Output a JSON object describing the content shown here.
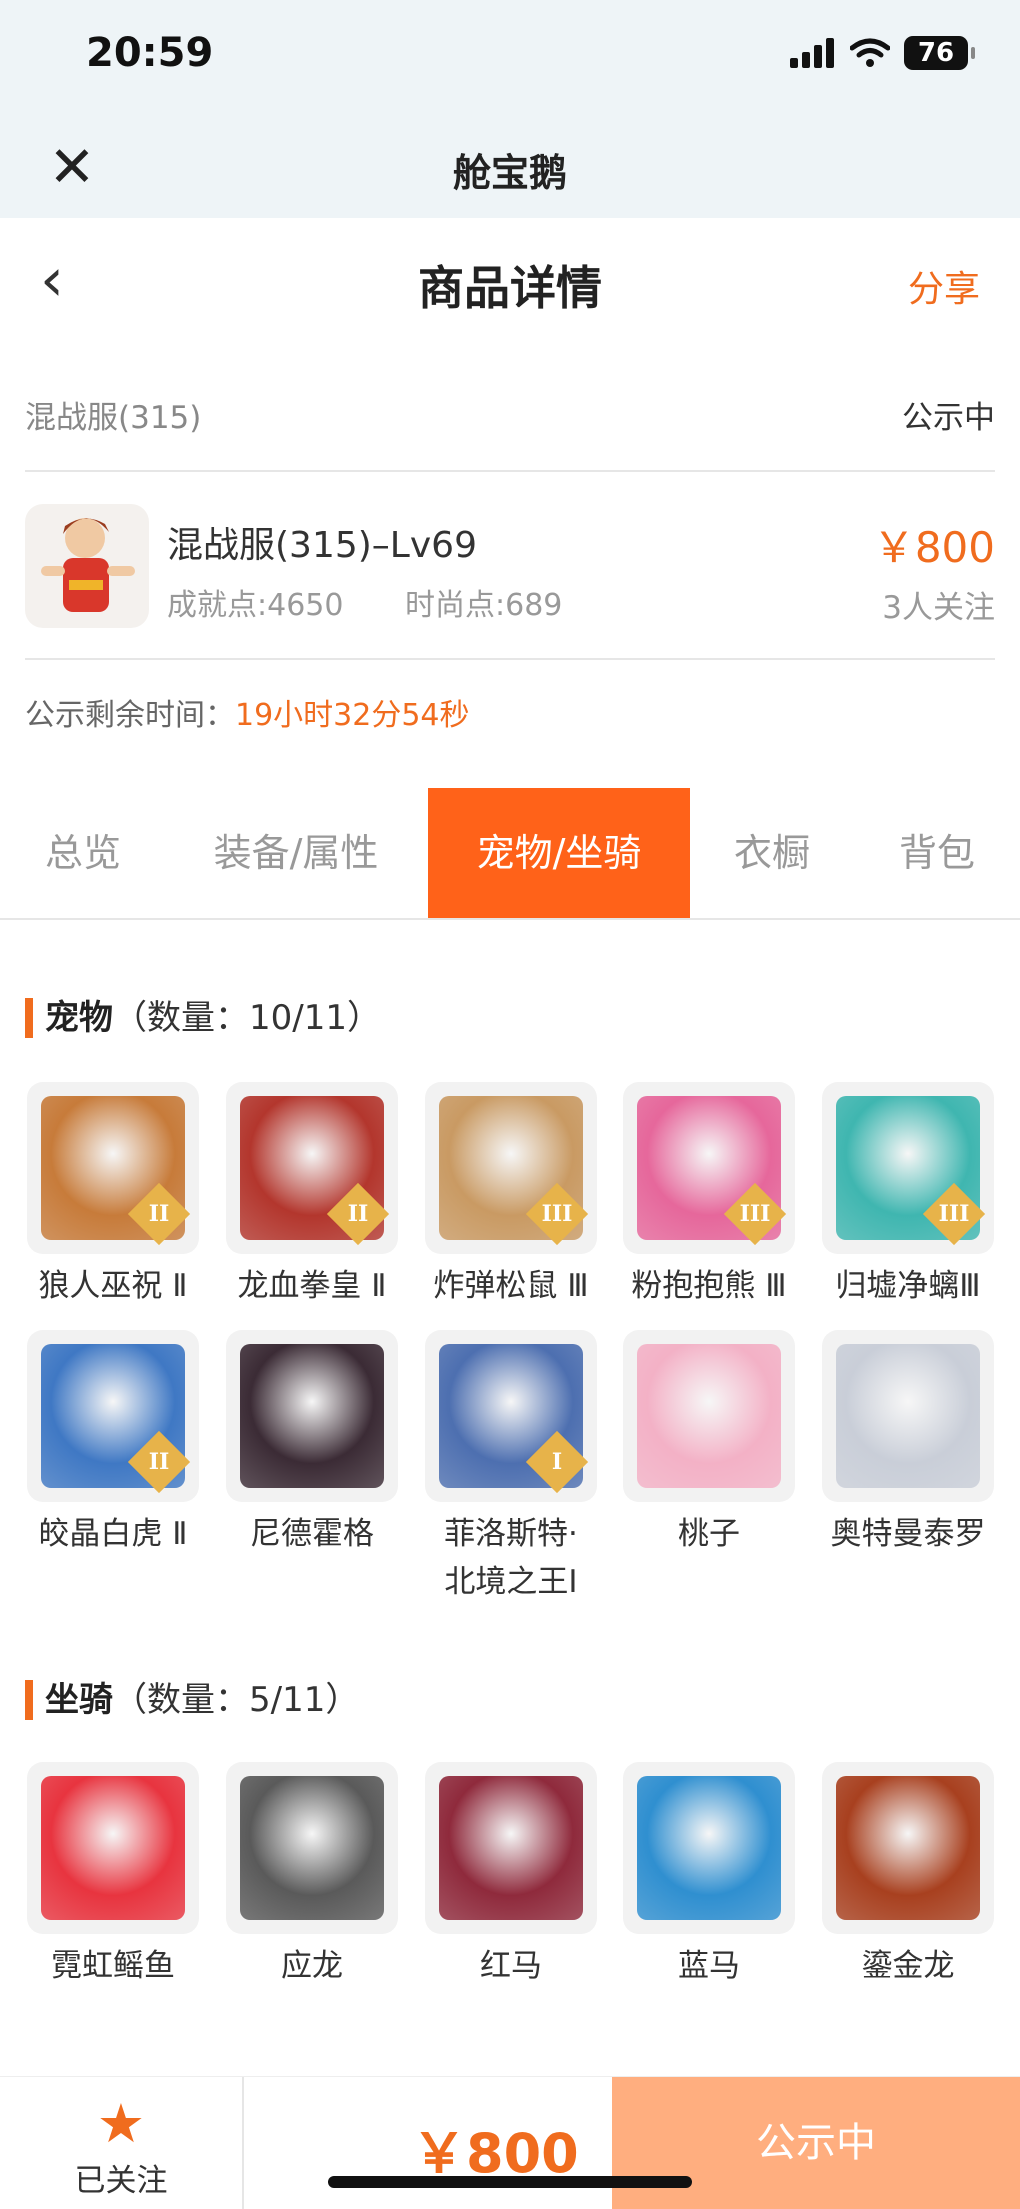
{
  "status_bar": {
    "time": "20:59",
    "battery": "76"
  },
  "nav": {
    "close_icon": "close-icon",
    "title": "舱宝鹅"
  },
  "header": {
    "back_icon": "chevron-left-icon",
    "title": "商品详情",
    "share": "分享"
  },
  "server": {
    "name": "混战服(315)",
    "status": "公示中"
  },
  "product": {
    "title": "混战服(315)–Lv69",
    "achievement": "成就点:4650",
    "fashion": "时尚点:689",
    "price": "￥800",
    "followers": "3人关注"
  },
  "remaining": {
    "label": "公示剩余时间：",
    "value": "19小时32分54秒"
  },
  "tabs": [
    {
      "label": "总览"
    },
    {
      "label": "装备/属性"
    },
    {
      "label": "宠物/坐骑",
      "active": true
    },
    {
      "label": "衣橱"
    },
    {
      "label": "背包"
    }
  ],
  "pets": {
    "title": "宠物",
    "count": "（数量：10/11）",
    "items": [
      {
        "name": "狼人巫祝 Ⅱ",
        "badge": "II",
        "color": "#c77b3a"
      },
      {
        "name": "龙血拳皇 Ⅱ",
        "badge": "II",
        "color": "#b3362d"
      },
      {
        "name": "炸弹松鼠 Ⅲ",
        "badge": "III",
        "color": "#c99a63"
      },
      {
        "name": "粉抱抱熊 Ⅲ",
        "badge": "III",
        "color": "#e6679b"
      },
      {
        "name": "归墟净螭Ⅲ",
        "badge": "III",
        "color": "#3fb6b0"
      },
      {
        "name": "皎晶白虎 Ⅱ",
        "badge": "II",
        "color": "#3f78c4"
      },
      {
        "name": "尼德霍格",
        "badge": "",
        "color": "#3b2b35"
      },
      {
        "name": "菲洛斯特·北境之王Ⅰ",
        "badge": "I",
        "color": "#4d6fb0"
      },
      {
        "name": "桃子",
        "badge": "",
        "color": "#f3b1c6"
      },
      {
        "name": "奥特曼泰罗",
        "badge": "",
        "color": "#c9ced8"
      }
    ]
  },
  "mounts": {
    "title": "坐骑",
    "count": "（数量：5/11）",
    "items": [
      {
        "name": "霓虹鳐鱼",
        "color": "#e8343f"
      },
      {
        "name": "应龙",
        "color": "#5a5a5a"
      },
      {
        "name": "红马",
        "color": "#8f2a3c"
      },
      {
        "name": "蓝马",
        "color": "#2f8fd0"
      },
      {
        "name": "鎏金龙",
        "color": "#a8401f"
      }
    ]
  },
  "bottom": {
    "follow_label": "已关注",
    "price": "￥800",
    "status": "公示中"
  }
}
